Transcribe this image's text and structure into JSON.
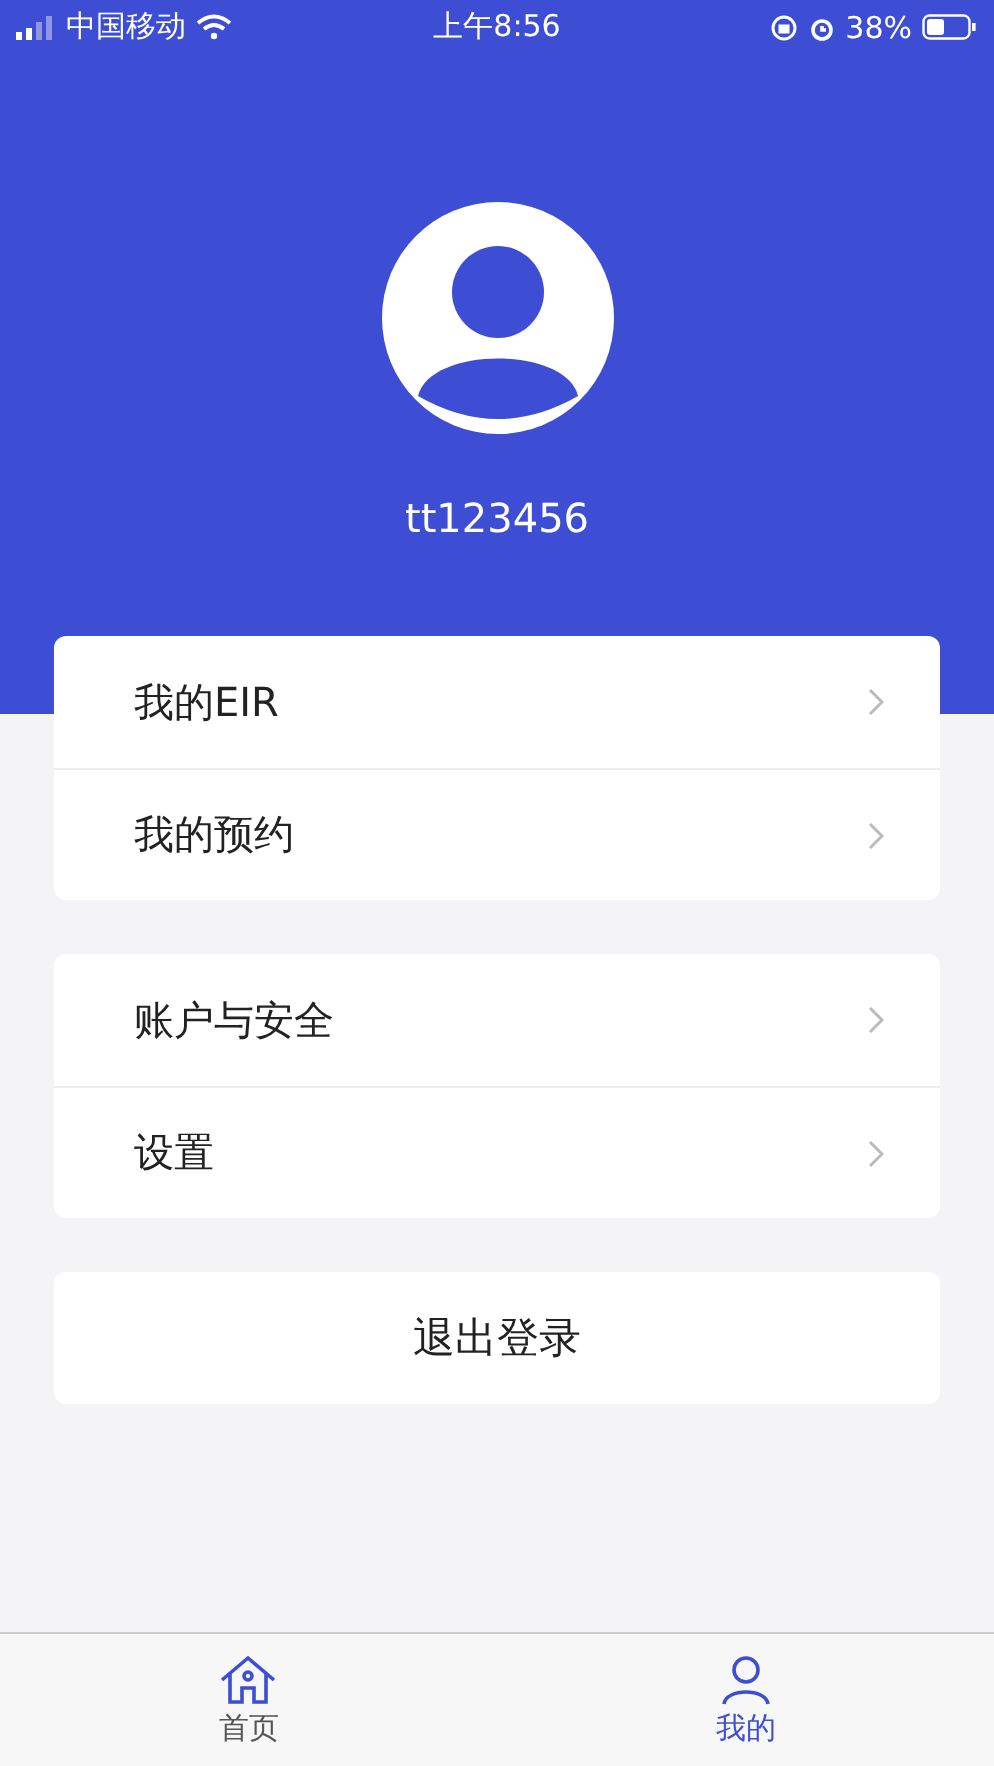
{
  "status_bar": {
    "carrier": "中国移动",
    "time": "上午8:56",
    "battery": "38%"
  },
  "profile": {
    "username": "tt123456"
  },
  "menu_groups": [
    {
      "items": [
        {
          "label": "我的EIR"
        },
        {
          "label": "我的预约"
        }
      ]
    },
    {
      "items": [
        {
          "label": "账户与安全"
        },
        {
          "label": "设置"
        }
      ]
    }
  ],
  "logout_button": "退出登录",
  "tab_bar": [
    {
      "label": "首页",
      "kind": "home",
      "selected": false
    },
    {
      "label": "我的",
      "kind": "profile",
      "selected": true
    }
  ]
}
